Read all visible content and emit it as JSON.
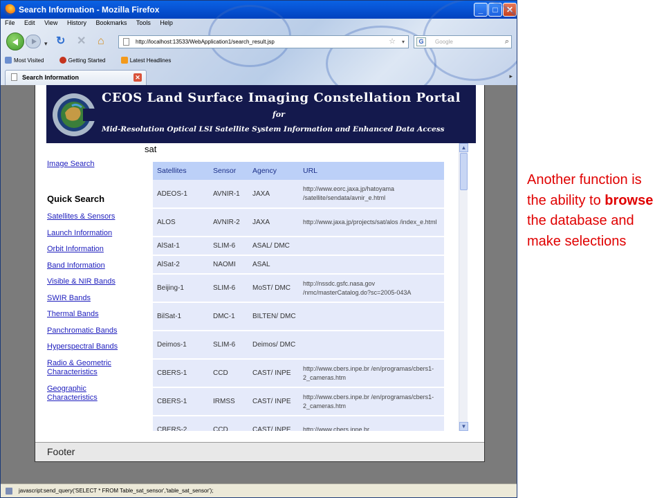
{
  "window": {
    "title": "Search Information - Mozilla Firefox"
  },
  "menu": [
    "File",
    "Edit",
    "View",
    "History",
    "Bookmarks",
    "Tools",
    "Help"
  ],
  "address": {
    "url": "http://localhost:13533/WebApplication1/search_result.jsp"
  },
  "search": {
    "placeholder": "Google"
  },
  "bookmarks": [
    "Most Visited",
    "Getting Started",
    "Latest Headlines"
  ],
  "tab": {
    "label": "Search Information"
  },
  "banner": {
    "title": "CEOS Land Surface Imaging Constellation Portal",
    "for": "for",
    "subtitle": "Mid-Resolution Optical LSI Satellite System Information and Enhanced Data Access"
  },
  "sidebar": {
    "image_search": "Image Search",
    "quick_search": "Quick Search",
    "links": [
      "Satellites & Sensors",
      "Launch Information",
      "Orbit Information",
      "Band Information",
      "Visible & NIR Bands",
      "SWIR Bands",
      "Thermal Bands",
      "Panchromatic Bands",
      "Hyperspectral Bands",
      "Radio & Geometric Characteristics",
      "Geographic Characteristics"
    ]
  },
  "main": {
    "query": "sat",
    "columns": [
      "Satellites",
      "Sensor",
      "Agency",
      "URL"
    ],
    "rows": [
      [
        "ADEOS-1",
        "AVNIR-1",
        "JAXA",
        "http://www.eorc.jaxa.jp/hatoyama /satellite/sendata/avnir_e.html"
      ],
      [
        "ALOS",
        "AVNIR-2",
        "JAXA",
        "http://www.jaxa.jp/projects/sat/alos /index_e.html"
      ],
      [
        "AlSat-1",
        "SLIM-6",
        "ASAL/ DMC",
        ""
      ],
      [
        "AlSat-2",
        "NAOMI",
        "ASAL",
        ""
      ],
      [
        "Beijing-1",
        "SLIM-6",
        "MoST/ DMC",
        "http://nssdc.gsfc.nasa.gov /nmc/masterCatalog.do?sc=2005-043A"
      ],
      [
        "BilSat-1",
        "DMC-1",
        "BILTEN/ DMC",
        ""
      ],
      [
        "Deimos-1",
        "SLIM-6",
        "Deimos/ DMC",
        ""
      ],
      [
        "CBERS-1",
        "CCD",
        "CAST/ INPE",
        "http://www.cbers.inpe.br /en/programas/cbers1-2_cameras.htm"
      ],
      [
        "CBERS-1",
        "IRMSS",
        "CAST/ INPE",
        "http://www.cbers.inpe.br /en/programas/cbers1-2_cameras.htm"
      ],
      [
        "CBERS-2",
        "CCD",
        "CAST/ INPE",
        "http://www.cbers.inpe.br"
      ]
    ]
  },
  "footer": {
    "text": "Footer"
  },
  "status": {
    "text": "javascript:send_query('SELECT * FROM Table_sat_sensor','table_sat_sensor');"
  },
  "note": {
    "before": "Another function is the ability to ",
    "bold": "browse",
    "after": " the database and make selections"
  }
}
